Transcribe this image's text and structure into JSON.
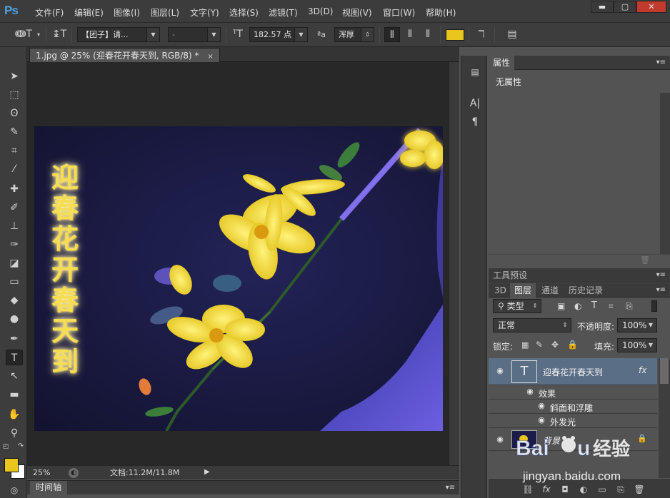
{
  "app": {
    "logo": "Ps"
  },
  "menu": [
    "文件(F)",
    "编辑(E)",
    "图像(I)",
    "图层(L)",
    "文字(Y)",
    "选择(S)",
    "滤镜(T)",
    "3D(D)",
    "视图(V)",
    "窗口(W)",
    "帮助(H)"
  ],
  "window_controls": {
    "minimize": "▬",
    "restore": "▢",
    "close": "✕"
  },
  "options_bar": {
    "font_family": "【团子】请...",
    "font_style": "-",
    "font_size": "182.57 点",
    "antialias": "浑厚",
    "color": "#e8c61e"
  },
  "document": {
    "tab_title": "1.jpg @ 25% (迎春花开春天到, RGB/8) *",
    "tab_close": "×",
    "artwork_text": [
      "迎",
      "春",
      "花",
      "开",
      "春",
      "天",
      "到"
    ],
    "zoom": "25%",
    "doc_info": "文档:11.2M/11.8M"
  },
  "timeline": {
    "tab": "时间轴"
  },
  "properties_panel": {
    "tab": "属性",
    "empty_text": "无属性"
  },
  "tool_presets": {
    "tab": "工具预设"
  },
  "layers_panel": {
    "tabs": [
      "3D",
      "图层",
      "通道",
      "历史记录"
    ],
    "active_tab": "图层",
    "filter_kind": "类型",
    "blend_mode": "正常",
    "opacity_label": "不透明度:",
    "opacity_value": "100%",
    "lock_label": "锁定:",
    "fill_label": "填充:",
    "fill_value": "100%",
    "layers": [
      {
        "name": "迎春花开春天到",
        "type": "text",
        "fx": "fx",
        "effects_label": "效果",
        "effects": [
          "斜面和浮雕",
          "外发光"
        ]
      },
      {
        "name": "背景",
        "type": "image"
      }
    ]
  },
  "watermark": {
    "brand": "Baidu经验",
    "url": "jingyan.baidu.com"
  },
  "colors": {
    "foreground": "#e8c61e",
    "background": "#ffffff",
    "accent": "#4aa3e8"
  }
}
